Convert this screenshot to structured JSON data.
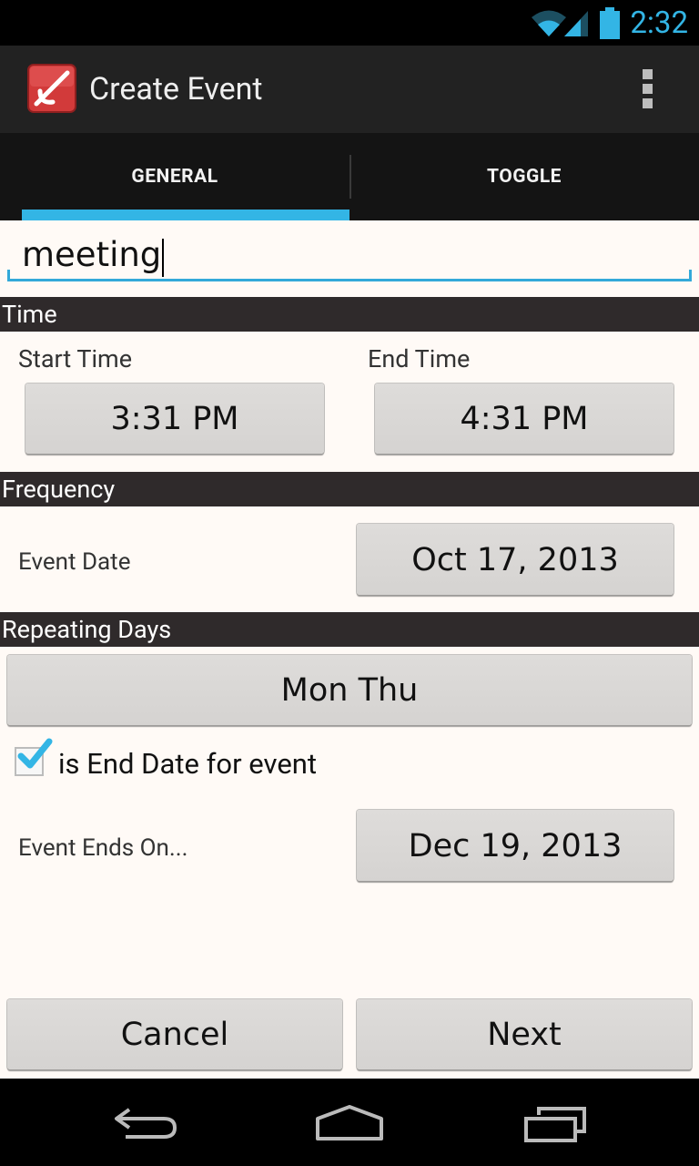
{
  "status_bar": {
    "time": "2:32"
  },
  "action_bar": {
    "title": "Create Event"
  },
  "tabs": [
    {
      "label": "GENERAL"
    },
    {
      "label": "TOGGLE"
    }
  ],
  "event_name": {
    "value": "meeting"
  },
  "time_section": {
    "header": "Time",
    "start_label": "Start Time",
    "end_label": "End Time",
    "start_value": "3:31 PM",
    "end_value": "4:31 PM"
  },
  "frequency_section": {
    "header": "Frequency",
    "event_date_label": "Event Date",
    "event_date_value": "Oct 17, 2013"
  },
  "repeating_section": {
    "header": "Repeating Days",
    "days_value": "Mon Thu"
  },
  "end_date": {
    "checkbox_label": "is End Date for event",
    "checked": true,
    "ends_on_label": "Event Ends On...",
    "ends_on_value": "Dec 19, 2013"
  },
  "footer": {
    "cancel_label": "Cancel",
    "next_label": "Next"
  },
  "colors": {
    "accent": "#33b5e5",
    "header_bg": "#2f2a2b",
    "content_bg": "#fffaf6",
    "icon_red": "#d23a3a"
  },
  "icons": [
    "wifi-icon",
    "signal-icon",
    "battery-icon",
    "app-icon",
    "overflow-menu-icon",
    "back-icon",
    "home-icon",
    "recents-icon"
  ]
}
